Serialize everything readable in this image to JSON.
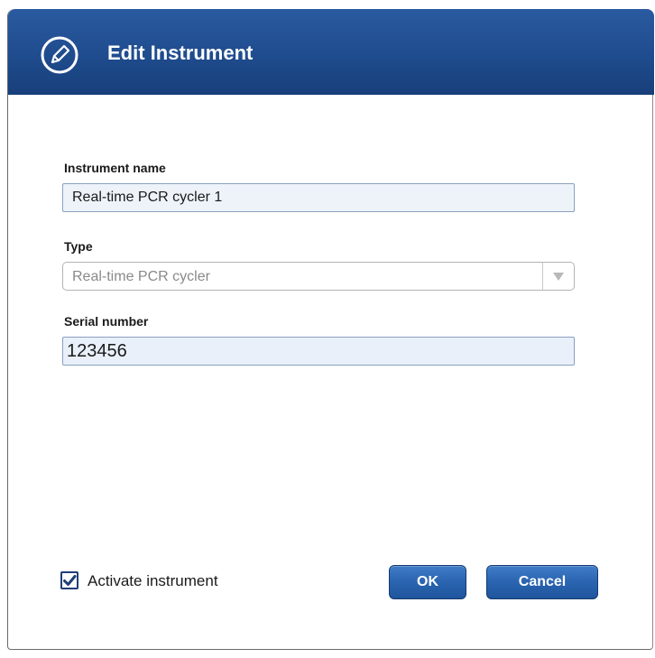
{
  "dialog": {
    "title": "Edit Instrument",
    "title_icon": "pencil-icon",
    "header_color": "#1f4c8e"
  },
  "form": {
    "instrument_name": {
      "label": "Instrument name",
      "value": "Real-time PCR cycler 1"
    },
    "type": {
      "label": "Type",
      "value": "Real-time PCR cycler",
      "arrow_icon": "dropdown-arrow-icon",
      "disabled": true
    },
    "serial_number": {
      "label": "Serial number",
      "value": "123456"
    }
  },
  "footer": {
    "activate_label": "Activate instrument",
    "activate_checked": true,
    "ok_label": "OK",
    "cancel_label": "Cancel",
    "button_color": "#2a64b0"
  }
}
